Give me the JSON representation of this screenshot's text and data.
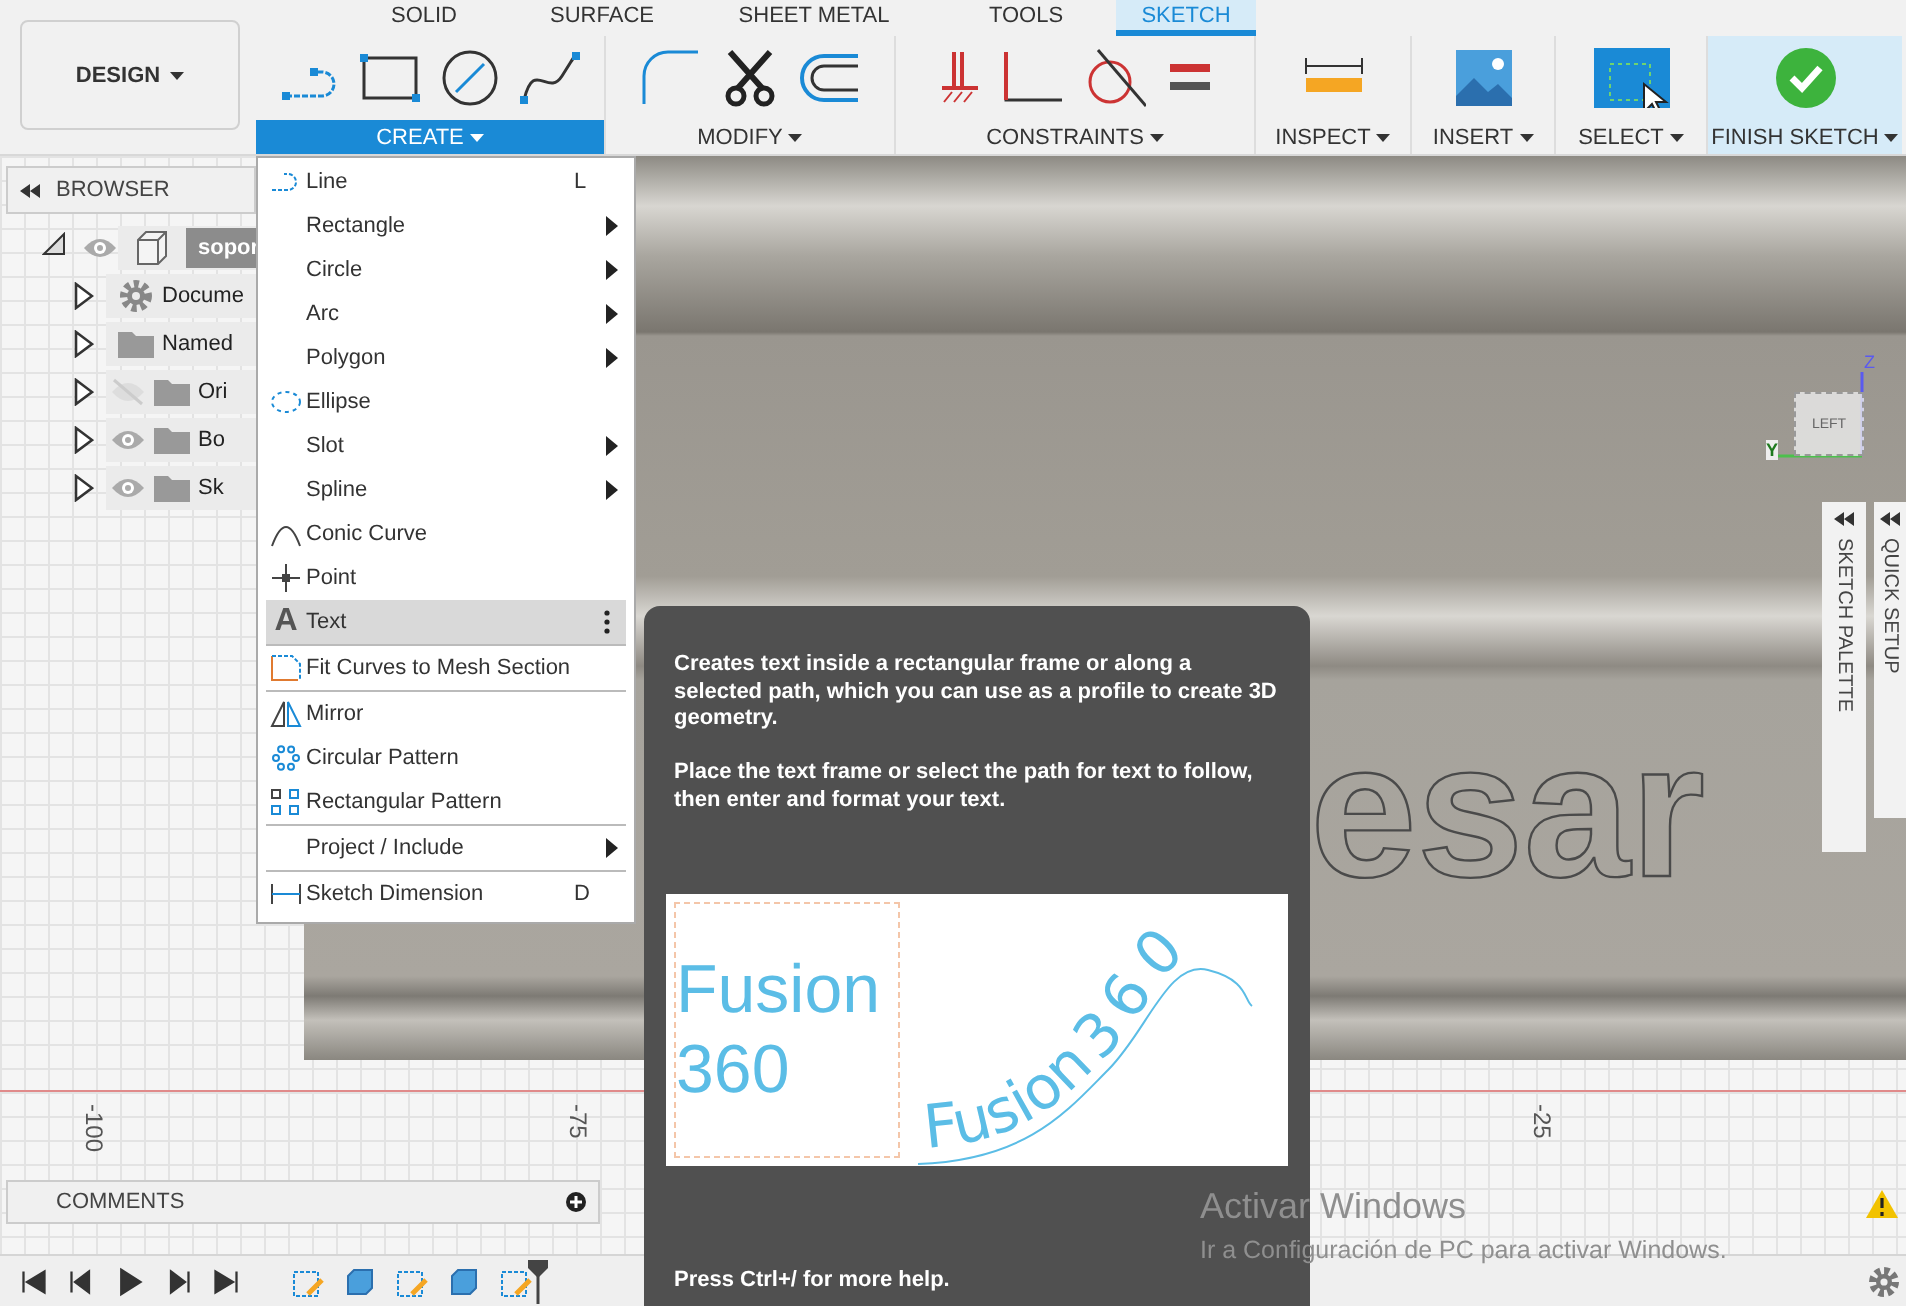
{
  "workspace": {
    "label": "DESIGN"
  },
  "tabs": [
    {
      "label": "SOLID",
      "selected": false
    },
    {
      "label": "SURFACE",
      "selected": false
    },
    {
      "label": "SHEET METAL",
      "selected": false
    },
    {
      "label": "TOOLS",
      "selected": false
    },
    {
      "label": "SKETCH",
      "selected": true
    }
  ],
  "toolbar_groups": [
    {
      "kind": "create",
      "label": "CREATE",
      "expanded": true
    },
    {
      "kind": "modify",
      "label": "MODIFY",
      "expanded": false
    },
    {
      "kind": "constraints",
      "label": "CONSTRAINTS",
      "expanded": false
    },
    {
      "kind": "inspect",
      "label": "INSPECT",
      "expanded": false
    },
    {
      "kind": "insert",
      "label": "INSERT",
      "expanded": false
    },
    {
      "kind": "select",
      "label": "SELECT",
      "expanded": false
    },
    {
      "kind": "finish",
      "label": "FINISH SKETCH",
      "expanded": false
    }
  ],
  "browser": {
    "title": "BROWSER",
    "items": [
      {
        "kind": "component",
        "label": "sopor",
        "visible": true,
        "expanded": true,
        "children": [
          {
            "kind": "settings",
            "label": "Docume",
            "expanded": false
          },
          {
            "kind": "folder",
            "label": "Named",
            "expanded": false
          },
          {
            "kind": "folder",
            "label": "Ori",
            "visible": false,
            "expanded": false
          },
          {
            "kind": "folder",
            "label": "Bo",
            "visible": true,
            "expanded": false
          },
          {
            "kind": "folder",
            "label": "Sk",
            "visible": true,
            "expanded": false
          }
        ]
      }
    ]
  },
  "create_menu": [
    [
      {
        "kind": "line",
        "label": "Line",
        "shortcut": "L",
        "submenu": false,
        "selected": false
      },
      {
        "kind": "plain",
        "label": "Rectangle",
        "submenu": true,
        "selected": false
      },
      {
        "kind": "plain",
        "label": "Circle",
        "submenu": true,
        "selected": false
      },
      {
        "kind": "plain",
        "label": "Arc",
        "submenu": true,
        "selected": false
      },
      {
        "kind": "plain",
        "label": "Polygon",
        "submenu": true,
        "selected": false
      },
      {
        "kind": "ellipse",
        "label": "Ellipse",
        "submenu": false,
        "selected": false
      },
      {
        "kind": "plain",
        "label": "Slot",
        "submenu": true,
        "selected": false
      },
      {
        "kind": "plain",
        "label": "Spline",
        "submenu": true,
        "selected": false
      },
      {
        "kind": "conic",
        "label": "Conic Curve",
        "submenu": false,
        "selected": false
      },
      {
        "kind": "point",
        "label": "Point",
        "submenu": false,
        "selected": false
      },
      {
        "kind": "text",
        "glyph": "A",
        "label": "Text",
        "submenu": false,
        "selected": true
      }
    ],
    [
      {
        "kind": "fit",
        "label": "Fit Curves to Mesh Section",
        "submenu": false,
        "selected": false
      }
    ],
    [
      {
        "kind": "mirror",
        "label": "Mirror",
        "submenu": false,
        "selected": false
      },
      {
        "kind": "circular",
        "label": "Circular Pattern",
        "submenu": false,
        "selected": false
      },
      {
        "kind": "rectangular",
        "label": "Rectangular Pattern",
        "submenu": false,
        "selected": false
      }
    ],
    [
      {
        "kind": "plain",
        "label": "Project / Include",
        "submenu": true,
        "selected": false
      }
    ],
    [
      {
        "kind": "dimension",
        "label": "Sketch Dimension",
        "shortcut": "D",
        "submenu": false,
        "selected": false
      }
    ]
  ],
  "tooltip": {
    "paragraphs": [
      "Creates text inside a rectangular frame or along a selected path, which you can use as a profile to create 3D geometry.",
      "Place the text frame or select the path for text to follow, then enter and format your text."
    ],
    "frame_text": [
      "Fusion",
      "360"
    ],
    "path_text": [
      "Fusion",
      "3",
      "6",
      "0"
    ],
    "footer": "Press Ctrl+/ for more help."
  },
  "viewport": {
    "model_text": "esar",
    "ruler_labels": [
      "-100",
      "-75",
      "-25"
    ],
    "viewcube": {
      "face": "LEFT",
      "axes": [
        "Z",
        "Y"
      ]
    }
  },
  "palettes": [
    {
      "label": "SKETCH PALETTE"
    },
    {
      "label": "QUICK SETUP"
    }
  ],
  "comments": {
    "label": "COMMENTS"
  },
  "watermark": {
    "title": "Activar Windows",
    "subtitle": "Ir a Configuración de PC para activar Windows."
  }
}
